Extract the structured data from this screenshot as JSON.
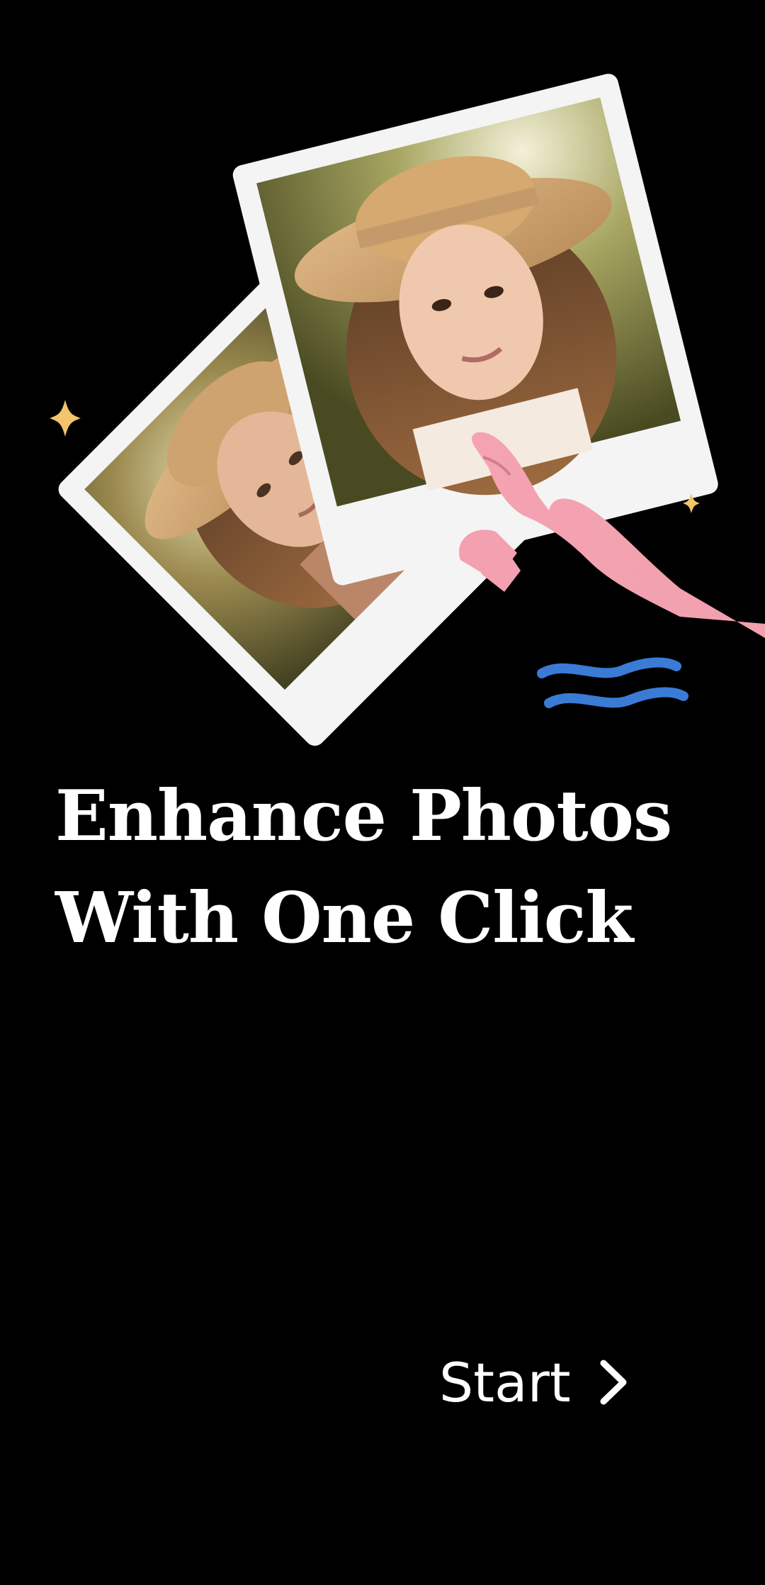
{
  "onboarding": {
    "headline_line1": "Enhance Photos",
    "headline_line2": "With One Click",
    "start_label": "Start",
    "start_icon": "chevron-right-icon"
  },
  "colors": {
    "background": "#000000",
    "text": "#ffffff",
    "hand": "#f5a3b3",
    "waves": "#3a7bd5",
    "sparkle": "#f2c46b",
    "polaroid_frame": "#f4f4f4"
  }
}
